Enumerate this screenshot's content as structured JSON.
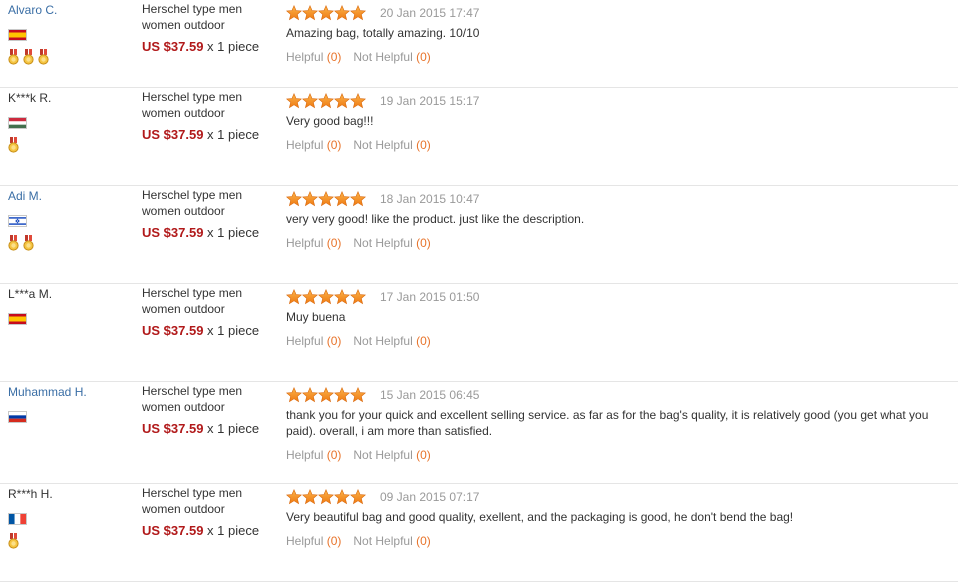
{
  "colors": {
    "price": "#b1191a",
    "link": "#3a6ea5",
    "star": "#f5891f",
    "vote_count": "#e8742b",
    "muted": "#999999"
  },
  "icons": {
    "star": "star-icon",
    "medal": "medal-icon",
    "flag": "flag-icon"
  },
  "feedback": [
    {
      "buyer": "Alvaro C.",
      "buyer_is_link": true,
      "country_flag": "spain",
      "medals": 3,
      "product": "Herschel type men women outdoor",
      "price": "US $37.59",
      "qty": " x 1 piece",
      "rating": 5,
      "date": "20 Jan 2015 17:47",
      "comment": "Amazing bag, totally amazing. 10/10",
      "helpful_label": "Helpful",
      "helpful_count": "(0)",
      "not_helpful_label": "Not Helpful",
      "not_helpful_count": "(0)"
    },
    {
      "buyer": "K***k R.",
      "buyer_is_link": false,
      "country_flag": "hungary",
      "medals": 1,
      "product": "Herschel type men women outdoor",
      "price": "US $37.59",
      "qty": " x 1 piece",
      "rating": 5,
      "date": "19 Jan 2015 15:17",
      "comment": "Very good bag!!!",
      "helpful_label": "Helpful",
      "helpful_count": "(0)",
      "not_helpful_label": "Not Helpful",
      "not_helpful_count": "(0)"
    },
    {
      "buyer": "Adi M.",
      "buyer_is_link": true,
      "country_flag": "israel",
      "medals": 2,
      "product": "Herschel type men women outdoor",
      "price": "US $37.59",
      "qty": " x 1 piece",
      "rating": 5,
      "date": "18 Jan 2015 10:47",
      "comment": "very very good! like the product. just like the description.",
      "helpful_label": "Helpful",
      "helpful_count": "(0)",
      "not_helpful_label": "Not Helpful",
      "not_helpful_count": "(0)"
    },
    {
      "buyer": "L***a M.",
      "buyer_is_link": false,
      "country_flag": "spain",
      "medals": 0,
      "product": "Herschel type men women outdoor",
      "price": "US $37.59",
      "qty": " x 1 piece",
      "rating": 5,
      "date": "17 Jan 2015 01:50",
      "comment": "Muy buena",
      "helpful_label": "Helpful",
      "helpful_count": "(0)",
      "not_helpful_label": "Not Helpful",
      "not_helpful_count": "(0)"
    },
    {
      "buyer": "Muhammad H.",
      "buyer_is_link": true,
      "country_flag": "russia",
      "medals": 0,
      "product": "Herschel type men women outdoor",
      "price": "US $37.59",
      "qty": " x 1 piece",
      "rating": 5,
      "date": "15 Jan 2015 06:45",
      "comment": "thank you for your quick and excellent selling service. as far as for the bag's quality, it is relatively good (you get what you paid). overall, i am more than satisfied.",
      "helpful_label": "Helpful",
      "helpful_count": "(0)",
      "not_helpful_label": "Not Helpful",
      "not_helpful_count": "(0)"
    },
    {
      "buyer": "R***h H.",
      "buyer_is_link": false,
      "country_flag": "france",
      "medals": 1,
      "product": "Herschel type men women outdoor",
      "price": "US $37.59",
      "qty": " x 1 piece",
      "rating": 5,
      "date": "09 Jan 2015 07:17",
      "comment": "Very beautiful bag and good quality, exellent, and the packaging is good, he don't bend the bag!",
      "helpful_label": "Helpful",
      "helpful_count": "(0)",
      "not_helpful_label": "Not Helpful",
      "not_helpful_count": "(0)"
    }
  ]
}
